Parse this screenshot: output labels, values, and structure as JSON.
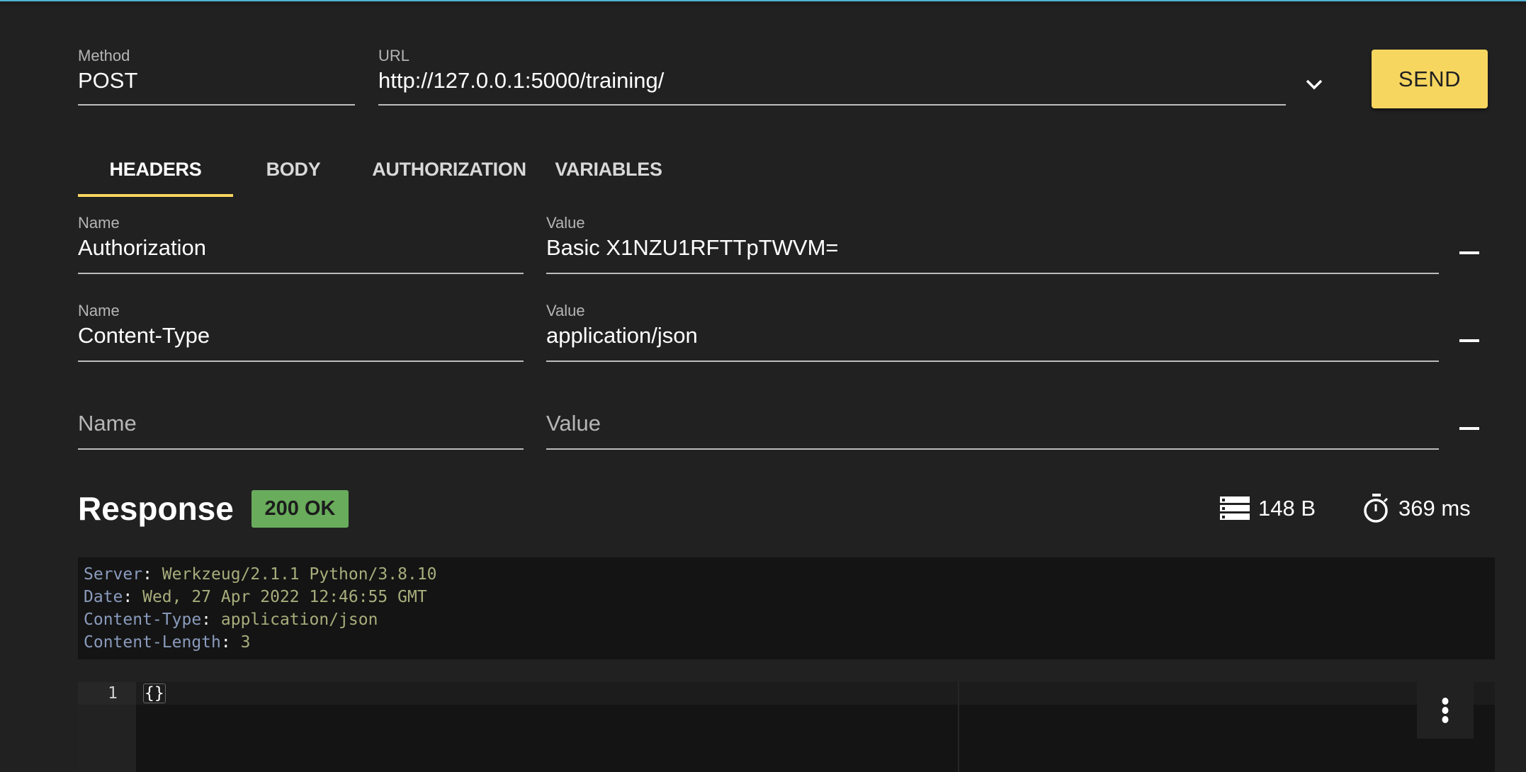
{
  "request": {
    "method_label": "Method",
    "method_value": "POST",
    "url_label": "URL",
    "url_value": "http://127.0.0.1:5000/training/",
    "send_label": "SEND"
  },
  "tabs": [
    {
      "label": "HEADERS",
      "active": true
    },
    {
      "label": "BODY",
      "active": false
    },
    {
      "label": "AUTHORIZATION",
      "active": false
    },
    {
      "label": "VARIABLES",
      "active": false
    }
  ],
  "headers": [
    {
      "name_label": "Name",
      "name": "Authorization",
      "value_label": "Value",
      "value": "Basic X1NZU1RFTTpTWVM="
    },
    {
      "name_label": "Name",
      "name": "Content-Type",
      "value_label": "Value",
      "value": "application/json"
    },
    {
      "name_placeholder": "Name",
      "value_placeholder": "Value"
    }
  ],
  "response": {
    "title": "Response",
    "status": "200 OK",
    "status_color": "#69ac5c",
    "size": "148 B",
    "time": "369 ms",
    "headers": [
      {
        "key": "Server",
        "value": "Werkzeug/2.1.1 Python/3.8.10"
      },
      {
        "key": "Date",
        "value": "Wed, 27 Apr 2022 12:46:55 GMT"
      },
      {
        "key": "Content-Type",
        "value": "application/json"
      },
      {
        "key": "Content-Length",
        "value": "3"
      }
    ],
    "body": {
      "line_number": "1",
      "content": "{}"
    }
  },
  "colors": {
    "accent": "#f7d660",
    "background": "#212121",
    "topbar": "#4fb3d1"
  }
}
